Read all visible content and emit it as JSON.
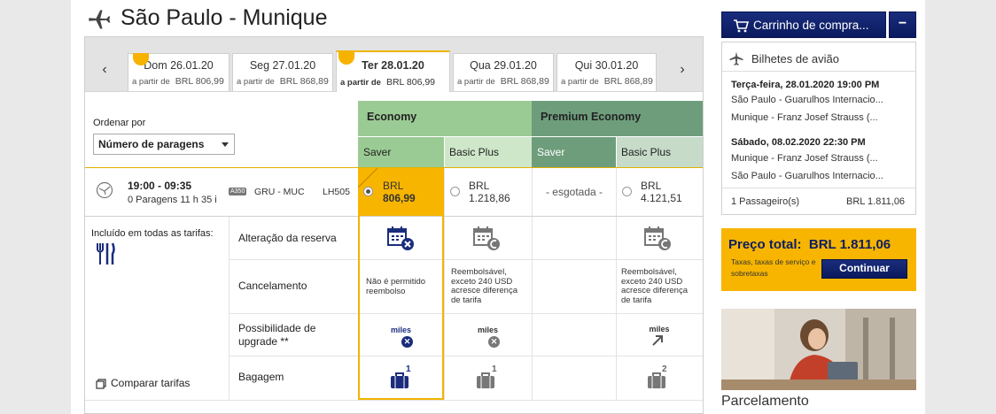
{
  "header": {
    "title": "São Paulo - Munique"
  },
  "date_tabs": [
    {
      "date": "Dom 26.01.20",
      "from": "a partir de",
      "price": "BRL 806,99",
      "active": false
    },
    {
      "date": "Seg 27.01.20",
      "from": "a partir de",
      "price": "BRL 868,89",
      "active": false
    },
    {
      "date": "Ter 28.01.20",
      "from": "a partir de",
      "price": "BRL 806,99",
      "active": true
    },
    {
      "date": "Qua 29.01.20",
      "from": "a partir de",
      "price": "BRL 868,89",
      "active": false
    },
    {
      "date": "Qui 30.01.20",
      "from": "a partir de",
      "price": "BRL 868,89",
      "active": false
    }
  ],
  "nav": {
    "prev": "‹",
    "next": "›"
  },
  "sort": {
    "label": "Ordenar por",
    "value": "Número de paragens"
  },
  "fare_headers": {
    "economy": "Economy",
    "premium": "Premium Economy",
    "economy_saver": "Saver",
    "economy_basic_plus": "Basic Plus",
    "premium_saver": "Saver",
    "premium_basic_plus": "Basic Plus"
  },
  "flight": {
    "time": "19:00 - 09:35",
    "stops": "0 Paragens 11 h 35 i",
    "aircraft": "A350",
    "route": "GRU - MUC",
    "flight_no": "LH505",
    "fares": [
      {
        "currency": "BRL",
        "amount": "806,99",
        "selected": true
      },
      {
        "currency": "BRL",
        "amount": "1.218,86",
        "selected": false
      },
      {
        "soldout": "- esgotada -"
      },
      {
        "currency": "BRL",
        "amount": "4.121,51",
        "selected": false
      }
    ]
  },
  "features": {
    "included_label": "Incluído em todas as tarifas:",
    "rows": [
      "Alteração da reserva",
      "Cancelamento",
      "Possibilidade de upgrade **",
      "Bagagem"
    ],
    "cancel_saver": "Não é permitido reembolso",
    "cancel_basic": "Reembolsável, exceto 240 USD acresce diferença de tarifa",
    "cancel_premium": "Reembolsável, exceto 240 USD acresce diferença de tarifa",
    "miles": "miles",
    "bag_saver": "1",
    "bag_basic": "1",
    "bag_premium": "2",
    "compare": "Comparar tarifas"
  },
  "cart": {
    "button": "Carrinho de compra...",
    "minus": "−",
    "section_title": "Bilhetes de avião",
    "outbound_date": "Terça-feira, 28.01.2020 19:00 PM",
    "outbound_from": "São Paulo - Guarulhos Internacio...",
    "outbound_to": "Munique - Franz Josef Strauss (...",
    "return_date": "Sábado, 08.02.2020 22:30 PM",
    "return_from": "Munique - Franz Josef Strauss (...",
    "return_to": "São Paulo - Guarulhos Internacio...",
    "passengers": "1 Passageiro(s)",
    "passengers_price": "BRL 1.811,06"
  },
  "total": {
    "label": "Preço total:",
    "value": "BRL 1.811,06",
    "note": "Taxas, taxas de serviço e sobretaxas",
    "continue": "Continuar"
  },
  "installments": "Parcelamento",
  "colors": {
    "economy": "#9bcb94",
    "economy_light": "#cfe7c9",
    "premium": "#6e9d7c",
    "premium_light": "#c6dbc8",
    "accent": "#f7b500",
    "navy": "#0d1d63"
  }
}
